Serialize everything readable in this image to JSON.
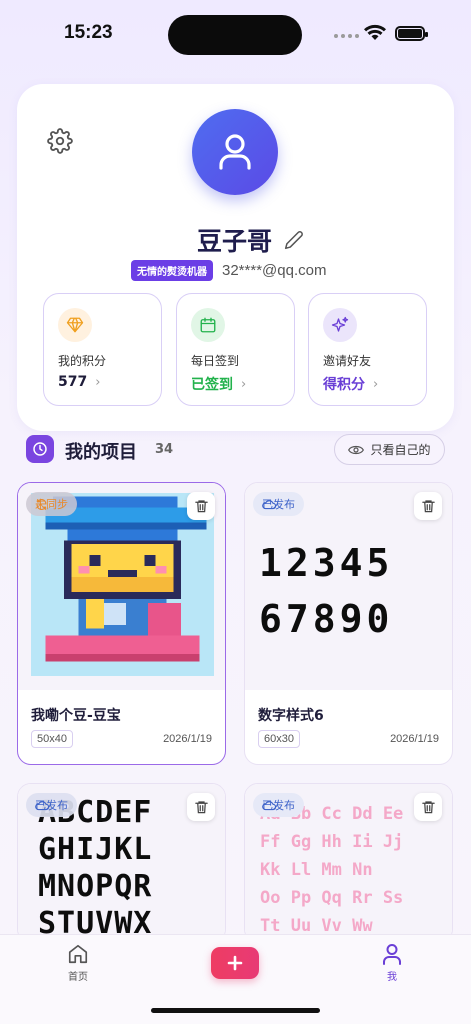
{
  "status_bar": {
    "time": "15:23"
  },
  "profile": {
    "username": "豆子哥",
    "title_badge": "无情的熨烫机器",
    "email": "32****@qq.com",
    "stats": [
      {
        "label": "我的积分",
        "value": "577",
        "color": "#1f1d3a",
        "icon": "diamond-icon"
      },
      {
        "label": "每日签到",
        "value": "已签到",
        "color": "#22b24c",
        "icon": "calendar-icon"
      },
      {
        "label": "邀请好友",
        "value": "得积分",
        "color": "#6a3fd6",
        "icon": "sparkle-icon"
      }
    ]
  },
  "projects": {
    "title": "我的项目",
    "count": "34",
    "filter_label": "只看自己的",
    "items": [
      {
        "name": "我嘞个豆-豆宝",
        "size": "50x40",
        "date": "2026/1/19",
        "status": "未同步"
      },
      {
        "name": "数字样式6",
        "size": "60x30",
        "date": "2026/1/19",
        "status": "已发布",
        "preview_text": [
          "12345",
          "67890"
        ]
      },
      {
        "name": "",
        "size": "",
        "date": "",
        "status": "已发布",
        "preview_text": [
          "ABCDEF",
          "GHIJKL",
          "MNOPQR",
          "STUVWX"
        ]
      },
      {
        "name": "",
        "size": "",
        "date": "",
        "status": "已发布",
        "preview_text": [
          "Aa Bb Cc Dd Ee",
          "Ff Gg Hh Ii Jj",
          "Kk Ll Mm Nn",
          "Oo Pp Qq Rr Ss",
          "Tt Uu Vv Ww"
        ]
      }
    ]
  },
  "tab_bar": {
    "home_label": "首页",
    "me_label": "我"
  },
  "colors": {
    "accent": "#6a3fd6",
    "avatar_gradient_start": "#4f6df0",
    "add_button": "#ee3d63",
    "signed_in_green": "#22b24c"
  }
}
